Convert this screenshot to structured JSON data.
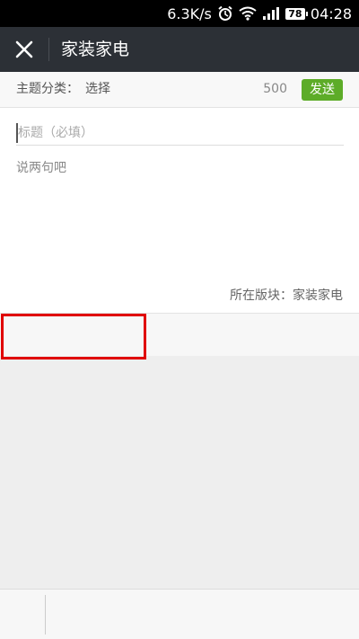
{
  "status_bar": {
    "network_speed": "6.3K/s",
    "battery": "78",
    "time": "04:28",
    "icons": [
      "alarm-icon",
      "wifi-icon",
      "signal-icon",
      "battery-icon"
    ]
  },
  "title_bar": {
    "title": "家装家电",
    "close_icon": "close-icon"
  },
  "topic_row": {
    "label": "主题分类：",
    "select": "选择",
    "count": "500",
    "send": "发送"
  },
  "compose": {
    "title_placeholder": "标题（必填）",
    "body_placeholder": "说两句吧",
    "board_info": "所在版块：家装家电"
  },
  "colors": {
    "title_bar": "#2c3036",
    "send_button": "#5dac28",
    "highlight": "#e00000"
  }
}
